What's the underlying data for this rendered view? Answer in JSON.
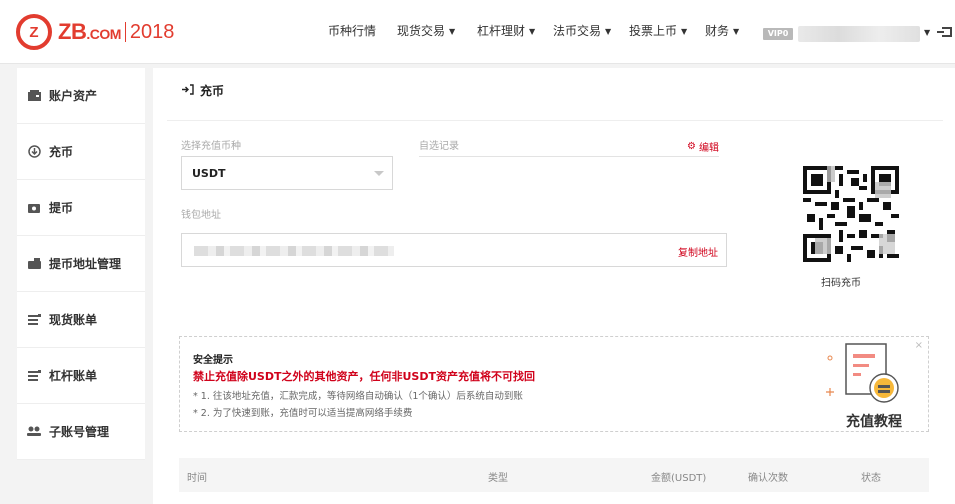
{
  "header": {
    "logo": {
      "mark": "Z",
      "brand": "ZB",
      "domain": ".COM",
      "year": "2018"
    },
    "nav": [
      {
        "label": "币种行情",
        "dropdown": false
      },
      {
        "label": "现货交易",
        "dropdown": true
      },
      {
        "label": "杠杆理财",
        "dropdown": true
      },
      {
        "label": "法币交易",
        "dropdown": true
      },
      {
        "label": "投票上币",
        "dropdown": true
      },
      {
        "label": "财务",
        "dropdown": true
      }
    ],
    "vip_badge": "VIP0",
    "caret": "▼"
  },
  "sidebar": {
    "items": [
      {
        "label": "账户资产",
        "icon": "wallet-icon"
      },
      {
        "label": "充币",
        "icon": "deposit-icon"
      },
      {
        "label": "提币",
        "icon": "withdraw-icon"
      },
      {
        "label": "提币地址管理",
        "icon": "address-book-icon"
      },
      {
        "label": "现货账单",
        "icon": "spot-bill-icon"
      },
      {
        "label": "杠杆账单",
        "icon": "margin-bill-icon"
      },
      {
        "label": "子账号管理",
        "icon": "sub-account-icon"
      }
    ]
  },
  "main": {
    "title": "充币",
    "coin_label": "选择充值币种",
    "coin_value": "USDT",
    "memo_label": "自选记录",
    "edit_label": "编辑",
    "address_label": "钱包地址",
    "copy_label": "复制地址",
    "qr_caption": "扫码充币"
  },
  "notice": {
    "title": "安全提示",
    "warning": "禁止充值除USDT之外的其他资产，任何非USDT资产充值将不可找回",
    "lines": [
      "* 1. 往该地址充值，汇款完成，等待网络自动确认（1个确认）后系统自动到账",
      "* 2. 为了快速到账，充值时可以适当提高网络手续费"
    ],
    "close": "×",
    "tutorial_label": "充值教程"
  },
  "table": {
    "headers": [
      "时间",
      "类型",
      "金额(USDT)",
      "确认次数",
      "状态"
    ]
  },
  "colors": {
    "brand_red": "#e23c2f",
    "link_red": "#d0021b"
  }
}
